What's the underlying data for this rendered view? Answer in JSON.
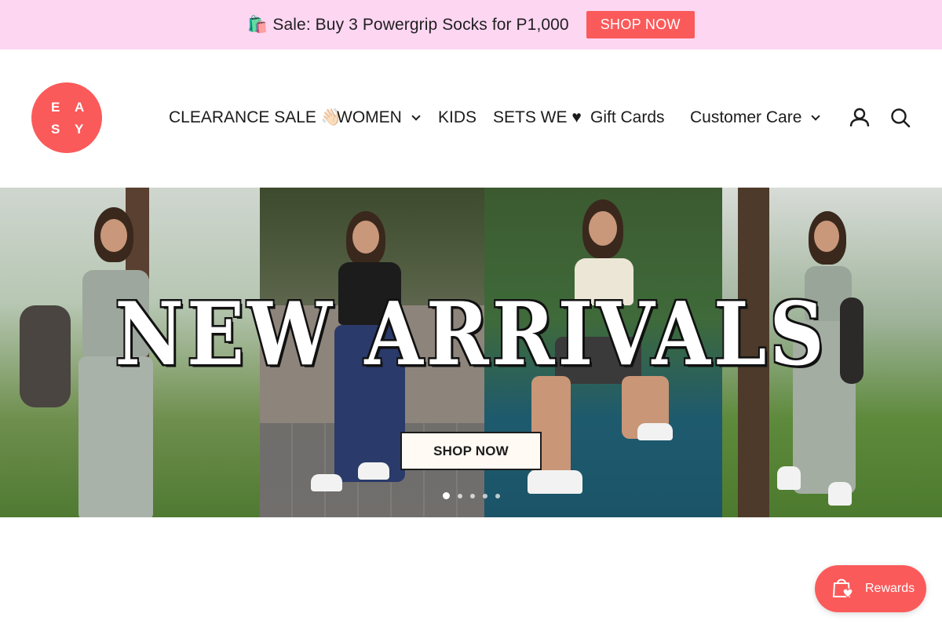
{
  "announcement": {
    "text": "🛍️ Sale: Buy 3 Powergrip Socks for P1,000",
    "button": "SHOP NOW"
  },
  "brand": {
    "letters": [
      "E",
      "A",
      "S",
      "Y"
    ],
    "color": "#fb5a5a"
  },
  "nav": {
    "items": [
      {
        "label": "CLEARANCE SALE 👋🏻"
      },
      {
        "label": "WOMEN"
      },
      {
        "label": "KIDS"
      },
      {
        "label": "SETS WE ♥"
      },
      {
        "label": "Gift Cards"
      },
      {
        "label": "Customer Care"
      }
    ],
    "icons": [
      "account-icon",
      "search-icon"
    ]
  },
  "hero": {
    "title": "NEW ARRIVALS",
    "button": "SHOP NOW",
    "slide_count": 5,
    "active_slide": 1
  },
  "rewards": {
    "label": "Rewards"
  },
  "colors": {
    "announcement_bg": "#fdd6f2",
    "accent": "#fb5a5a"
  }
}
